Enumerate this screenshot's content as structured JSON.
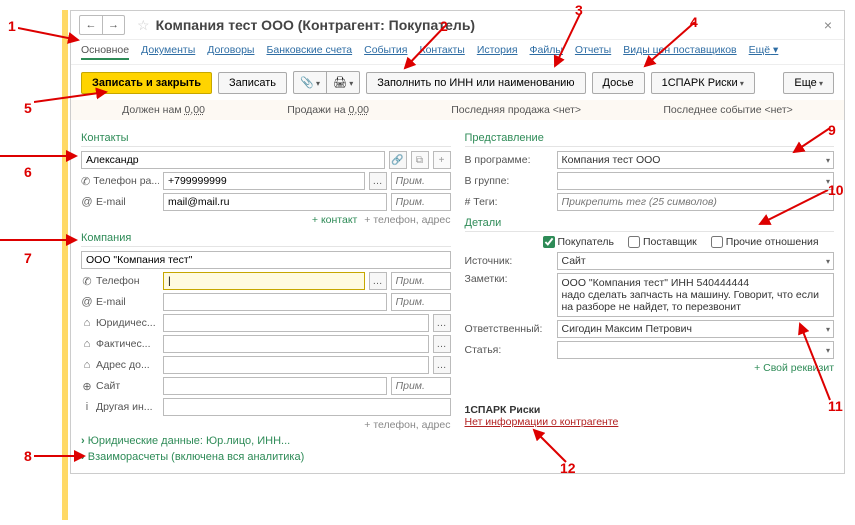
{
  "title": "Компания тест ООО (Контрагент: Покупатель)",
  "tabs": {
    "main": "Основное",
    "docs": "Документы",
    "contracts": "Договоры",
    "bank": "Банковские счета",
    "events": "События",
    "contacts": "Контакты",
    "history": "История",
    "files": "Файлы",
    "reports": "Отчеты",
    "supplier_prices": "Виды цен поставщиков",
    "more": "Ещё"
  },
  "toolbar": {
    "save_close": "Записать и закрыть",
    "save": "Записать",
    "fill_inn": "Заполнить по ИНН или наименованию",
    "dossier": "Досье",
    "spark": "1СПАРК Риски",
    "more": "Еще"
  },
  "status": {
    "debt": "Должен нам 0,00",
    "sales": "Продажи на 0,00",
    "last_sale": "Последняя продажа <нет>",
    "last_event": "Последнее событие <нет>"
  },
  "contacts": {
    "title": "Контакты",
    "name_value": "Александр",
    "phone_label": "Телефон ра...",
    "phone_value": "+799999999",
    "email_label": "E-mail",
    "email_value": "mail@mail.ru",
    "prim_placeholder": "Прим.",
    "add_contact": "+ контакт",
    "add_phone": "+ телефон, адрес"
  },
  "company": {
    "title": "Компания",
    "name_value": "ООО \"Компания тест\"",
    "phone_label": "Телефон",
    "email_label": "E-mail",
    "legal_label": "Юридичес...",
    "actual_label": "Фактичес...",
    "delivery_label": "Адрес до...",
    "site_label": "Сайт",
    "other_label": "Другая ин...",
    "add_phone": "+ телефон, адрес"
  },
  "representation": {
    "title": "Представление",
    "prog_label": "В программе:",
    "prog_value": "Компания тест ООО",
    "group_label": "В группе:",
    "tags_label": "# Теги:",
    "tags_placeholder": "Прикрепить тег (25 символов)"
  },
  "details": {
    "title": "Детали",
    "buyer": "Покупатель",
    "supplier": "Поставщик",
    "other_rel": "Прочие отношения",
    "source_label": "Источник:",
    "source_value": "Сайт",
    "notes_label": "Заметки:",
    "notes_value": "ООО \"Компания тест\" ИНН 540444444\nнадо сделать запчасть на машину. Говорит, что если на разборе не найдет, то перезвонит",
    "resp_label": "Ответственный:",
    "resp_value": "Сигодин Максим Петрович",
    "article_label": "Статья:",
    "own_requisite": "+ Свой реквизит"
  },
  "spark": {
    "title": "1СПАРК Риски",
    "no_info": "Нет информации о контрагенте"
  },
  "collapsibles": {
    "legal": "Юридические данные: Юр.лицо, ИНН...",
    "settlements": "Взаиморасчеты (включена вся аналитика)"
  },
  "annotations": [
    "1",
    "2",
    "3",
    "4",
    "5",
    "6",
    "7",
    "8",
    "9",
    "10",
    "11",
    "12"
  ]
}
